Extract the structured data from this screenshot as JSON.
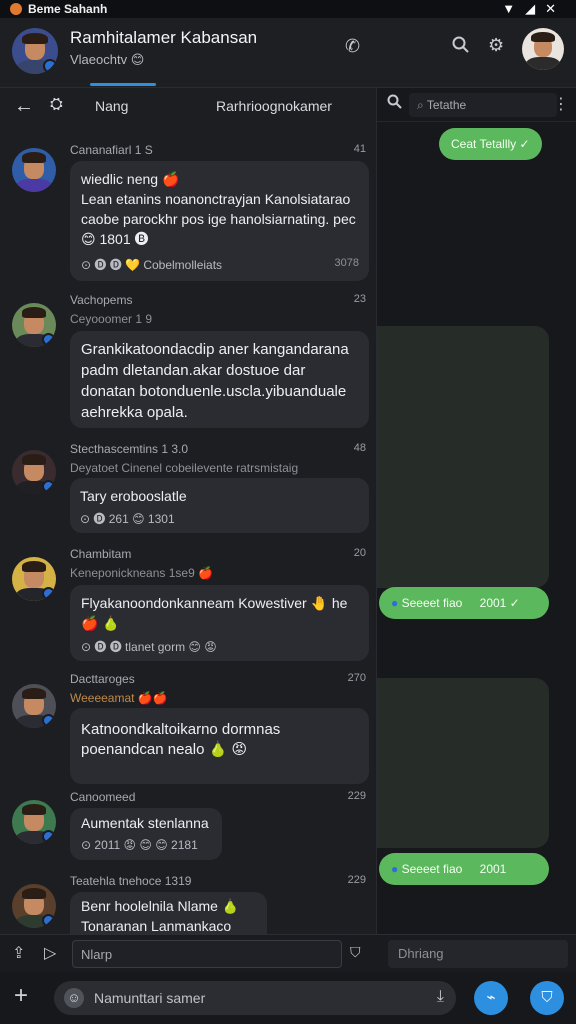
{
  "status": {
    "app_title": "Beme Sahanh"
  },
  "header": {
    "name": "Ramhitalamer Kabansan",
    "subtitle": "Vlaeochtv 😊"
  },
  "subbar": {
    "tab_left": "Nang",
    "tab_right": "Rarhrioognokamer"
  },
  "right_panel": {
    "search_placeholder": "Tetathe",
    "pill_top": "Ceat Tetallly ✓",
    "pill_mid_left": "Seeeet fiao",
    "pill_mid_right": "2001 ✓",
    "pill_bot_left": "Seeeet fiao",
    "pill_bot_right": "2001"
  },
  "messages": [
    {
      "sender": "Cananafiarl 1 S",
      "time": "41",
      "text_head": "wiedlic neng 🍎",
      "text": "Lean etanins noanonctrayjan Kanolsiatarao caobe parockhr pos ige hanolsiarnating. pec 😊 1801 🅑",
      "reacts": "⊙ 🅓 🅓 💛 Cobelmolleiats",
      "rtime": "3078"
    },
    {
      "sender": "Vachopems",
      "time": "23",
      "subline": "Ceyooomer 1 9",
      "text": "Grankikatoondacdip aner kangandarana padm dletandan.akar dostuoe dar donatan botonduenle.uscla.yibuanduale aehrekka opala."
    },
    {
      "sender": "Stecthascemtins 1 3.0",
      "time": "48",
      "subline": "Deyatoet Cinenel cobeilevente ratrsmistaig",
      "text": "Tary erobooslatle",
      "reacts": "⊙ 🅓 261 😊 1301"
    },
    {
      "sender": "Chambitam",
      "time": "20",
      "subline": "Keneponickneans 1se9 🍎",
      "text": "Flyakanoondonkanneam Kowestiver 🤚 he 🍎 🍐",
      "reacts": "⊙ 🅓 🅓 tlanet gorm 😊 😡"
    },
    {
      "sender": "Dacttaroges",
      "time": "270",
      "subline": "Weeeeamat 🍎🍎",
      "text": "Katnoondkaltoikarno dormnas poenandcan nealo 🍐 😡"
    },
    {
      "sender": "Canoomeed",
      "time": "229",
      "text": "Aumentak stenlanna",
      "reacts": "⊙ 2011 😡 😊 😊 2181"
    },
    {
      "sender": "Teatehla tnehoce 1319",
      "time": "229",
      "text_head": "Benr hoolelnila Nlame 🍐",
      "text": "Tonaranan Lanmankaco kian"
    }
  ],
  "input": {
    "placeholder": "Nlarp",
    "right_placeholder": "Dhriang"
  },
  "composer": {
    "placeholder": "Namunttari samer"
  }
}
